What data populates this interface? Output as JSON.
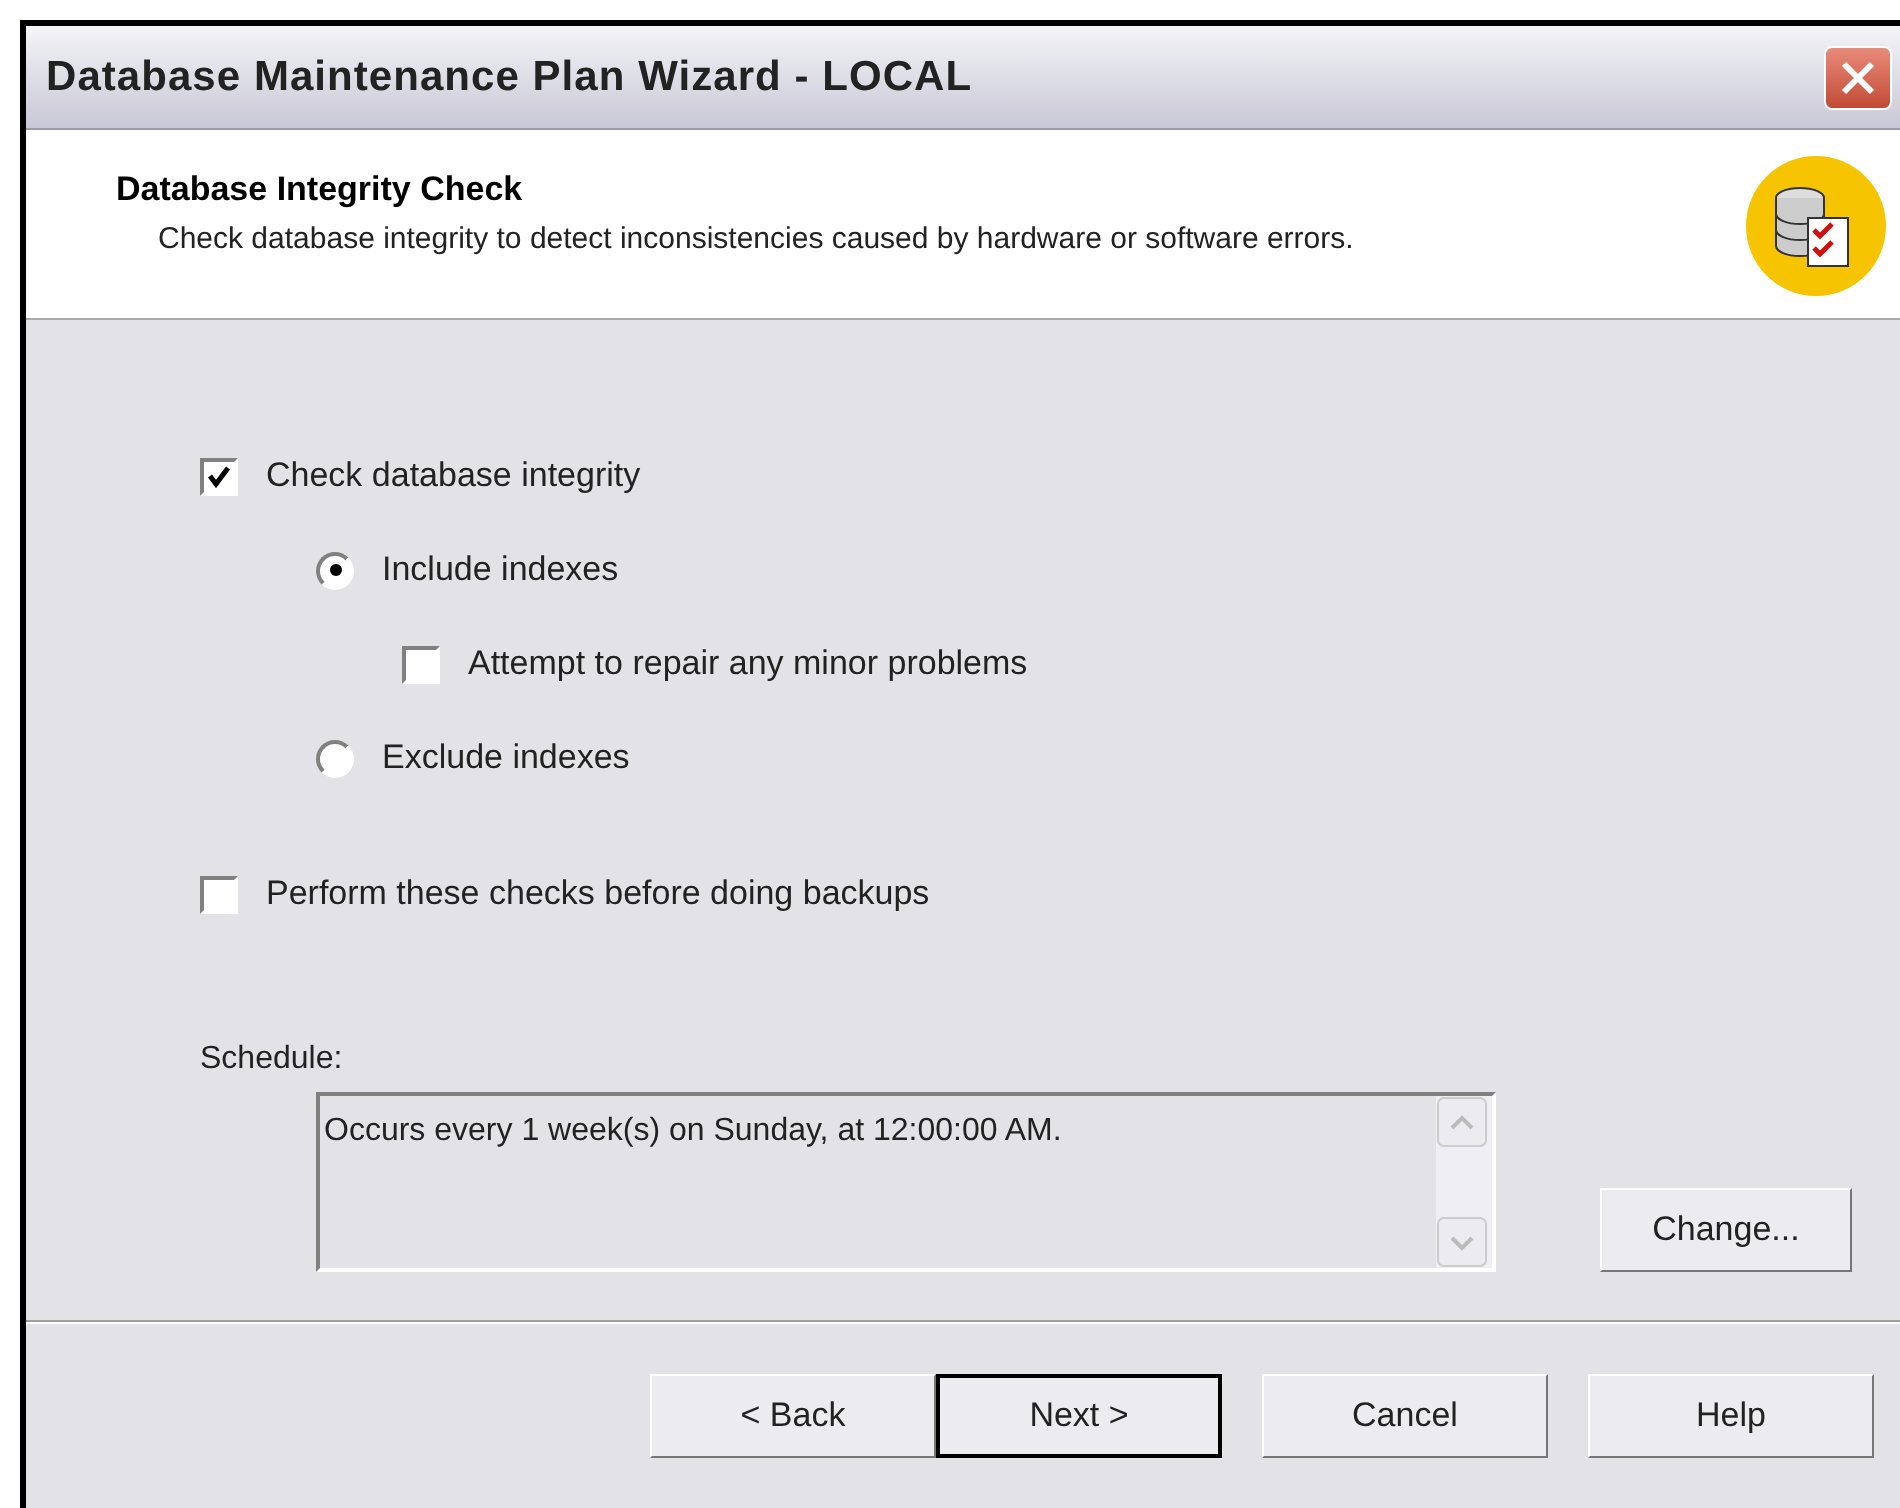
{
  "window": {
    "title": "Database Maintenance Plan Wizard - LOCAL"
  },
  "header": {
    "title": "Database Integrity Check",
    "description": "Check database integrity to detect inconsistencies caused by hardware or software errors."
  },
  "options": [
    {
      "kind": "checkbox",
      "label": "Check database integrity",
      "checked": true,
      "children": [
        {
          "kind": "radio",
          "label": "Include indexes",
          "selected": true,
          "children": [
            {
              "kind": "checkbox",
              "label": "Attempt to repair any minor problems",
              "checked": false
            }
          ]
        },
        {
          "kind": "radio",
          "label": "Exclude indexes",
          "selected": false
        }
      ]
    },
    {
      "kind": "checkbox",
      "label": "Perform these checks before doing backups",
      "checked": false
    }
  ],
  "schedule": {
    "label": "Schedule:",
    "value": "Occurs every 1 week(s) on Sunday, at 12:00:00 AM.",
    "button": "Change..."
  },
  "buttons": [
    {
      "label": "< Back",
      "default": false
    },
    {
      "label": "Next >",
      "default": true
    },
    {
      "label": "Cancel",
      "default": false
    },
    {
      "label": "Help",
      "default": false
    }
  ]
}
